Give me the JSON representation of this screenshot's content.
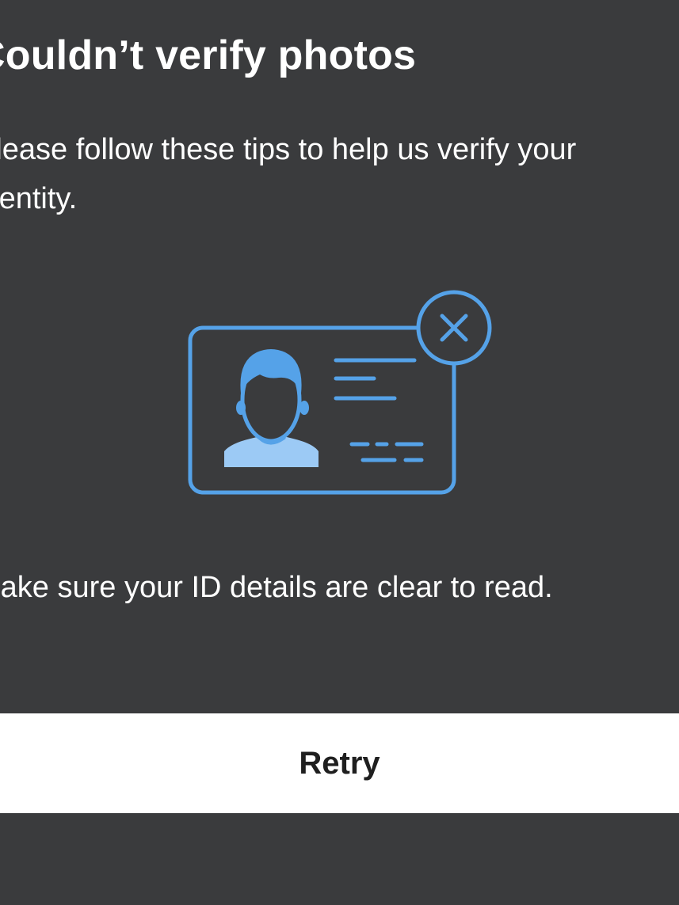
{
  "header": {
    "title": "Couldn’t verify photos"
  },
  "body": {
    "subtitle": "Please follow these tips to help us verify your identity.",
    "illustration_icon": "id-card-error-icon",
    "tip": "Make sure your ID details are clear to read."
  },
  "actions": {
    "retry_label": "Retry"
  },
  "colors": {
    "background": "#3a3b3d",
    "accent": "#55a2e8",
    "accent_light": "#9ccaf5",
    "button_bg": "#ffffff",
    "button_text": "#1f1f1f"
  }
}
